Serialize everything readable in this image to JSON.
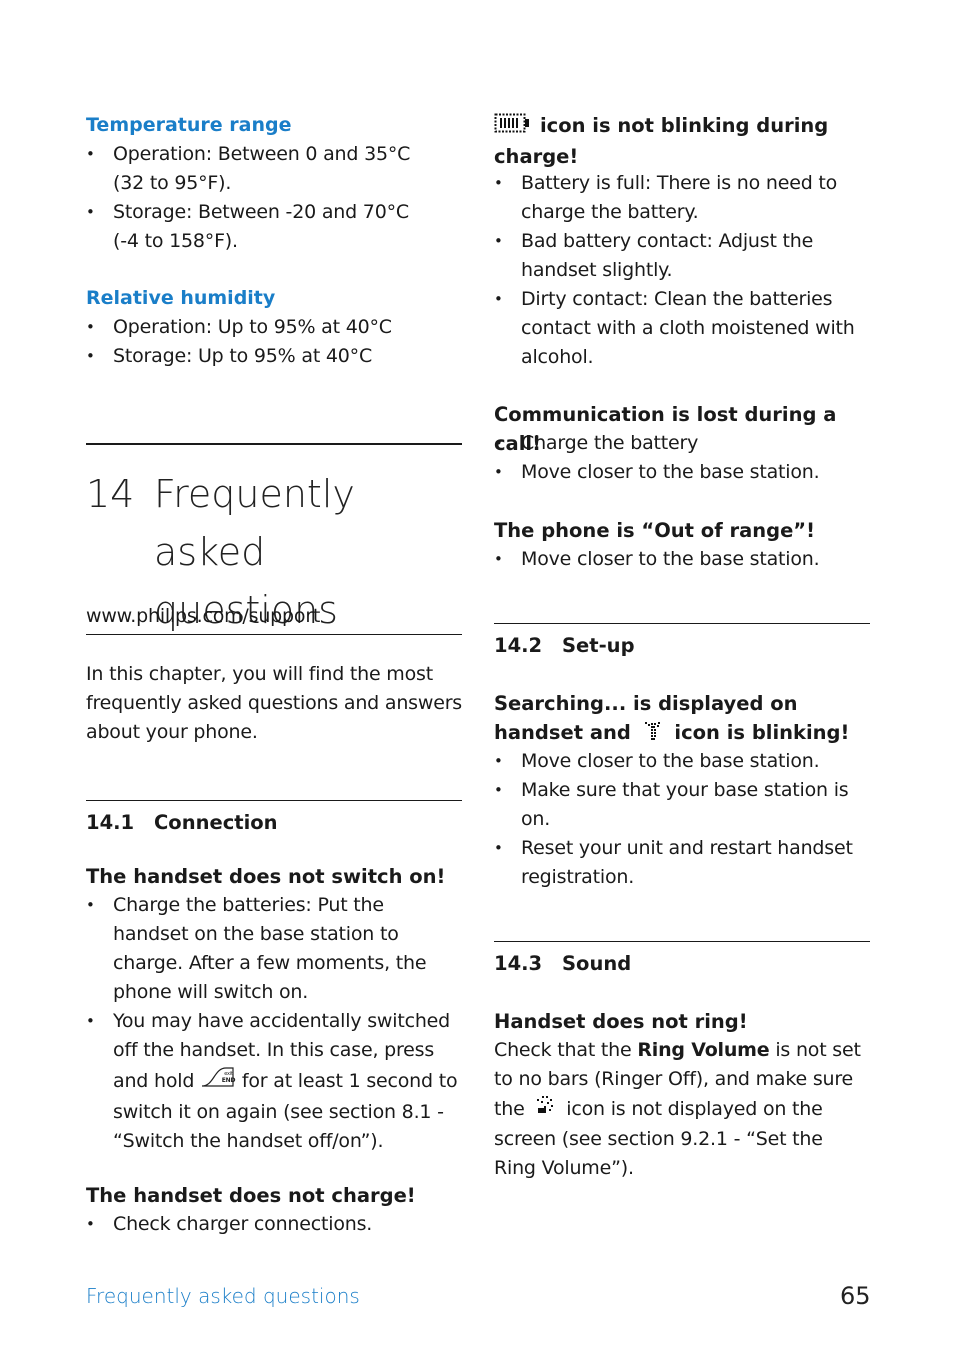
{
  "left": {
    "temperature": {
      "heading": "Temperature range",
      "items": [
        "Operation: Between 0 and 35°C (32 to 95°F).",
        "Storage: Between -20 and 70°C (-4 to 158°F)."
      ]
    },
    "humidity": {
      "heading": "Relative humidity",
      "items": [
        "Operation: Up to 95% at 40°C",
        "Storage: Up to 95% at 40°C"
      ]
    },
    "chapter": {
      "number": "14",
      "title": "Frequently asked questions"
    },
    "url": "www.philips.com/support",
    "intro": "In this chapter, you will find the most frequently asked questions and answers about your phone.",
    "section_14_1": {
      "number": "14.1",
      "title": "Connection"
    },
    "q_switch_on": {
      "heading": "The handset does not switch on!",
      "item1": "Charge the batteries: Put the handset on the base station to charge. After a few moments, the phone will switch on.",
      "item2_a": "You may have accidentally switched off the handset. In this case, press and hold",
      "item2_b": "for at least 1 second to switch it on again (see section 8.1 - “Switch the handset off/on”)."
    },
    "q_charge": {
      "heading": "The handset does not charge!",
      "items": [
        "Check charger connections."
      ]
    }
  },
  "right": {
    "q_battery_icon": {
      "heading_after_icon": "icon is not blinking during charge!",
      "items": [
        "Battery is full: There is no need to charge the battery.",
        "Bad battery contact: Adjust the handset slightly.",
        "Dirty contact: Clean the batteries contact with a cloth moistened with alcohol."
      ]
    },
    "q_comm_lost": {
      "heading": "Communication is lost during a call!",
      "items": [
        "Charge the battery",
        "Move closer to the base station."
      ]
    },
    "q_out_of_range": {
      "heading": "The phone is “Out of range”!",
      "items": [
        "Move closer to the base station."
      ]
    },
    "section_14_2": {
      "number": "14.2",
      "title": "Set-up"
    },
    "q_searching": {
      "heading_a": "Searching... is displayed on handset and",
      "heading_b": "icon is blinking!",
      "items": [
        "Move closer to the base station.",
        "Make sure that your base station is on.",
        "Reset your unit and restart handset registration."
      ]
    },
    "section_14_3": {
      "number": "14.3",
      "title": "Sound"
    },
    "q_ring": {
      "heading": "Handset does not ring!",
      "text_a": "Check that the",
      "text_bold": "Ring Volume",
      "text_b": "is not set to no bars (Ringer Off), and make sure the",
      "text_c": "icon is not displayed on the screen (see section 9.2.1 - “Set the Ring Volume”)."
    }
  },
  "footer": {
    "section": "Frequently asked questions",
    "page": "65"
  }
}
